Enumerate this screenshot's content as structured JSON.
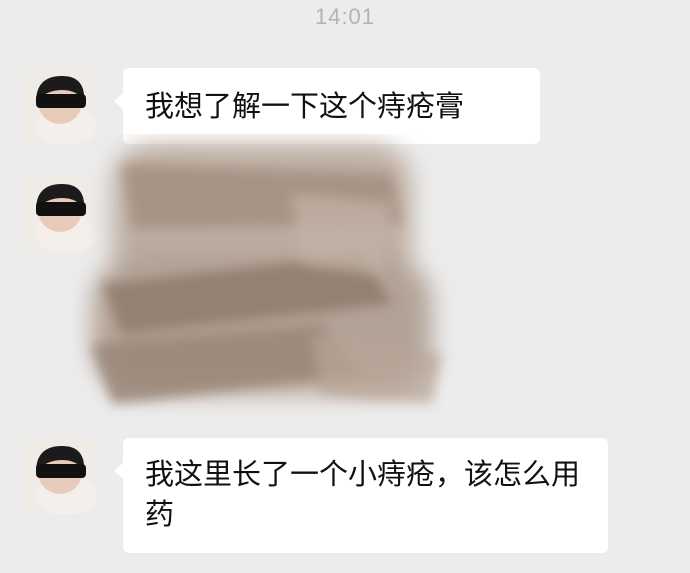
{
  "status": {
    "time": "14:01"
  },
  "messages": [
    {
      "sender": "user",
      "text": "我想了解一下这个痔疮膏"
    },
    {
      "sender": "user",
      "type": "image",
      "content": "blurred-image"
    },
    {
      "sender": "user",
      "text": "我这里长了一个小痔疮，该怎么用药"
    }
  ],
  "colors": {
    "background": "#ececec",
    "bubble": "#ffffff",
    "timestamp": "#b3b3b3",
    "blur_tone": "#9c8a7c"
  },
  "icons": {
    "avatar": "user-avatar-photo"
  }
}
